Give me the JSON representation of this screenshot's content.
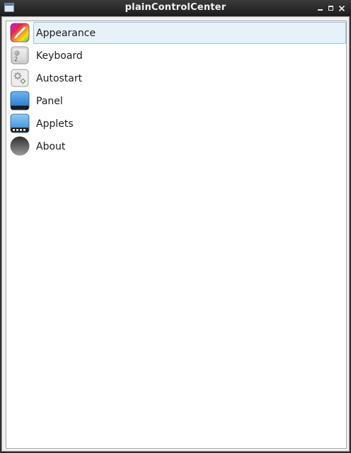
{
  "window": {
    "title": "plainControlCenter"
  },
  "list": {
    "items": [
      {
        "label": "Appearance",
        "icon": "appearance-icon",
        "selected": true
      },
      {
        "label": "Keyboard",
        "icon": "keyboard-icon",
        "selected": false
      },
      {
        "label": "Autostart",
        "icon": "autostart-icon",
        "selected": false
      },
      {
        "label": "Panel",
        "icon": "panel-icon",
        "selected": false
      },
      {
        "label": "Applets",
        "icon": "applets-icon",
        "selected": false
      },
      {
        "label": "About",
        "icon": "about-icon",
        "selected": false
      }
    ]
  },
  "colors": {
    "selection_bg": "#e6f1f9",
    "selection_border": "#9bc3dd",
    "titlebar": "#2a2a2a"
  }
}
